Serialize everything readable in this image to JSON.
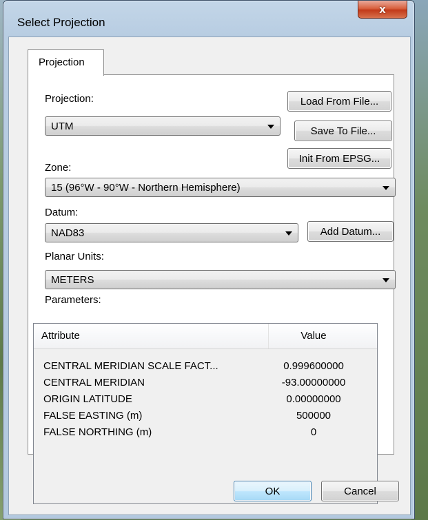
{
  "window": {
    "title": "Select Projection",
    "close_label": "x"
  },
  "tabs": [
    {
      "label": "Projection"
    }
  ],
  "form": {
    "projection_label": "Projection:",
    "projection_value": "UTM",
    "zone_label": "Zone:",
    "zone_value": "15 (96°W - 90°W - Northern Hemisphere)",
    "datum_label": "Datum:",
    "datum_value": "NAD83",
    "planar_units_label": "Planar Units:",
    "planar_units_value": "METERS",
    "parameters_label": "Parameters:"
  },
  "buttons": {
    "load_from_file": "Load From File...",
    "save_to_file": "Save To File...",
    "init_from_epsg": "Init From EPSG...",
    "add_datum": "Add Datum...",
    "ok": "OK",
    "cancel": "Cancel"
  },
  "parameters": {
    "columns": [
      "Attribute",
      "Value"
    ],
    "rows": [
      {
        "attribute": "CENTRAL MERIDIAN SCALE FACT...",
        "value": "0.999600000"
      },
      {
        "attribute": "CENTRAL MERIDIAN",
        "value": "-93.00000000"
      },
      {
        "attribute": "ORIGIN LATITUDE",
        "value": "0.00000000"
      },
      {
        "attribute": "FALSE EASTING (m)",
        "value": "500000"
      },
      {
        "attribute": "FALSE NORTHING (m)",
        "value": "0"
      }
    ]
  },
  "icons": {
    "close": "close-icon",
    "dropdown": "chevron-down-icon"
  },
  "colors": {
    "titlebar": "#b8cde2",
    "close_button": "#c23a1a",
    "default_button_border": "#3c7fb1"
  }
}
